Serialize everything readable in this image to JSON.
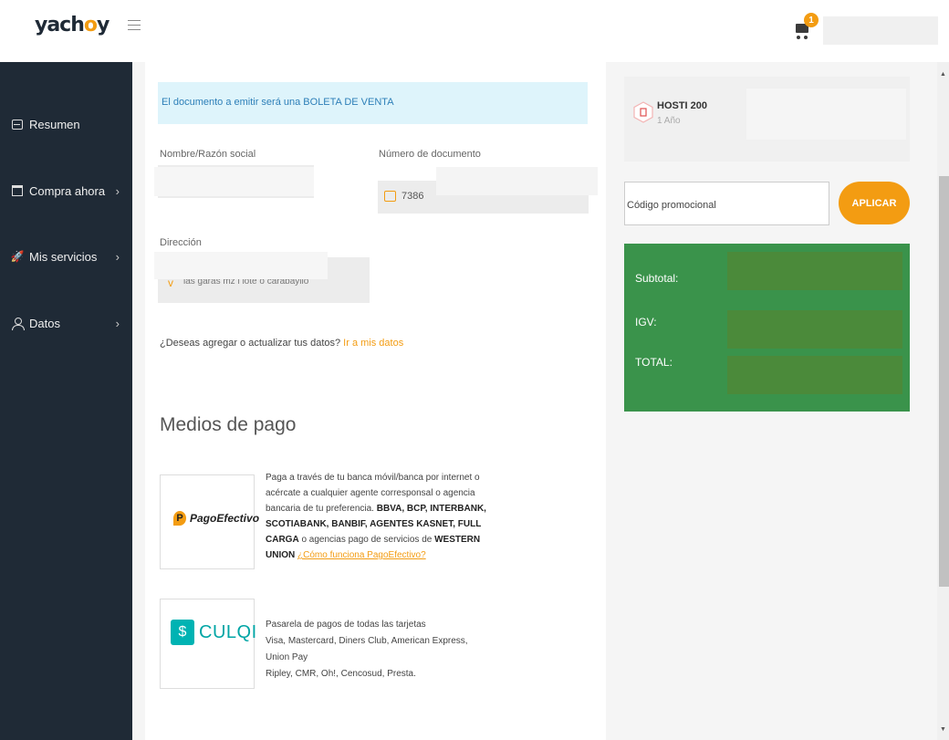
{
  "header": {
    "logo_prefix": "yach",
    "logo_o": "o",
    "logo_suffix": "y",
    "cart_badge": "1"
  },
  "sidebar": {
    "items": [
      {
        "label": "Resumen"
      },
      {
        "label": "Compra ahora",
        "chevron": "›"
      },
      {
        "label": "Mis servicios",
        "chevron": "›"
      },
      {
        "label": "Datos",
        "chevron": "›"
      }
    ]
  },
  "form": {
    "banner": "El documento a emitir será una BOLETA DE VENTA",
    "name_label": "Nombre/Razón social",
    "doc_label": "Número de documento",
    "doc_value": "7386",
    "address_label": "Dirección",
    "address_value": "las garas mz l lote o carabayllo",
    "update_text": "¿Deseas agregar o actualizar tus datos?",
    "update_link": "Ir a mis datos"
  },
  "payment": {
    "title": "Medios de pago",
    "pagoefectivo": {
      "logo_text": "PagoEfectivo",
      "desc_1": "Paga a través de tu banca móvil/banca por internet o acércate a cualquier agente corresponsal o agencia bancaria de tu preferencia.",
      "desc_bold_1": "BBVA, BCP, INTERBANK, SCOTIABANK, BANBIF, AGENTES KASNET, FULL CARGA",
      "desc_2": "o agencias pago de servicios de",
      "desc_bold_2": "WESTERN UNION",
      "link": "¿Cómo funciona PagoEfectivo?"
    },
    "culqi": {
      "logo_symbol": "$",
      "logo_text": "CULQI",
      "line_1": "Pasarela de pagos de todas las tarjetas",
      "line_2": "Visa, Mastercard, Diners Club, American Express, Union Pay",
      "line_3": "Ripley, CMR, Oh!, Cencosud, Presta."
    }
  },
  "order": {
    "product_name": "HOSTI 200",
    "product_period": "1 Año",
    "promo_placeholder": "Código promocional",
    "promo_button": "APLICAR",
    "subtotal_label": "Subtotal:",
    "igv_label": "IGV:",
    "total_label": "TOTAL:"
  },
  "colors": {
    "sidebar": "#1f2a36",
    "accent": "#f39c12",
    "totals_bg": "#3a934b",
    "banner_bg": "#def4fb"
  }
}
